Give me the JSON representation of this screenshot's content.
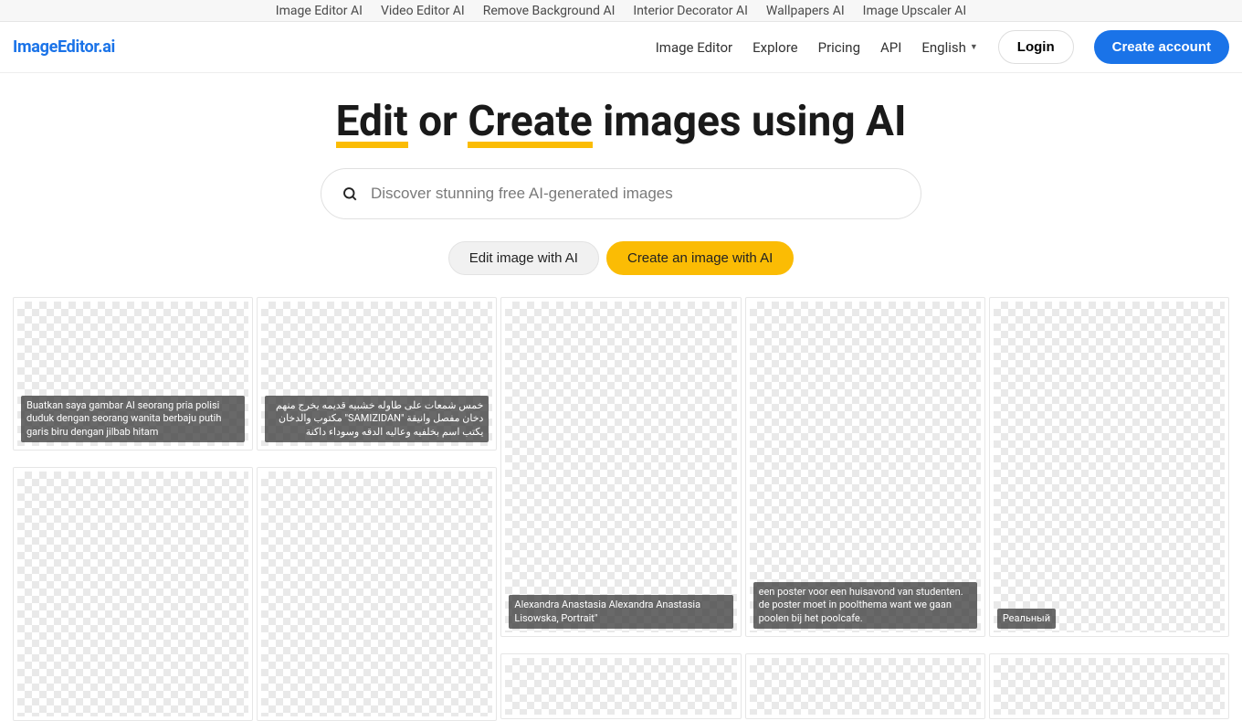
{
  "top_nav": {
    "image_editor_ai": "Image Editor AI",
    "video_editor_ai": "Video Editor AI",
    "remove_bg_ai": "Remove Background AI",
    "interior_decorator_ai": "Interior Decorator AI",
    "wallpapers_ai": "Wallpapers AI",
    "image_upscaler_ai": "Image Upscaler AI"
  },
  "logo": "ImageEditor.ai",
  "main_nav": {
    "image_editor": "Image Editor",
    "explore": "Explore",
    "pricing": "Pricing",
    "api": "API",
    "language": "English",
    "login": "Login",
    "create_account": "Create account"
  },
  "hero": {
    "edit": "Edit",
    "or": " or ",
    "create": "Create",
    "tail": " images using AI"
  },
  "search": {
    "placeholder": "Discover stunning free AI-generated images"
  },
  "actions": {
    "edit_image": "Edit image with AI",
    "create_image": "Create an image with AI"
  },
  "gallery": {
    "col1": {
      "c1": "Buatkan saya gambar AI seorang pria polisi duduk dengan seorang wanita berbaju putih garis biru dengan jilbab hitam"
    },
    "col2": {
      "c1": "خمس شمعات على طاوله خشبيه قديمه يخرج منهم دخان مفصل وانيقة \"SAMIZIDAN\" مكتوب والدخان يكتب اسم بخلفيه وعاليه الدقه وسوداء داكنة"
    },
    "col3": {
      "c1": "Alexandra Anastasia Alexandra Anastasia Lisowska, Portrait\""
    },
    "col4": {
      "c1": "een poster voor een huisavond van studenten. de poster moet in poolthema want we gaan poolen bij het poolcafe."
    },
    "col5": {
      "c1": "Реальный"
    }
  }
}
